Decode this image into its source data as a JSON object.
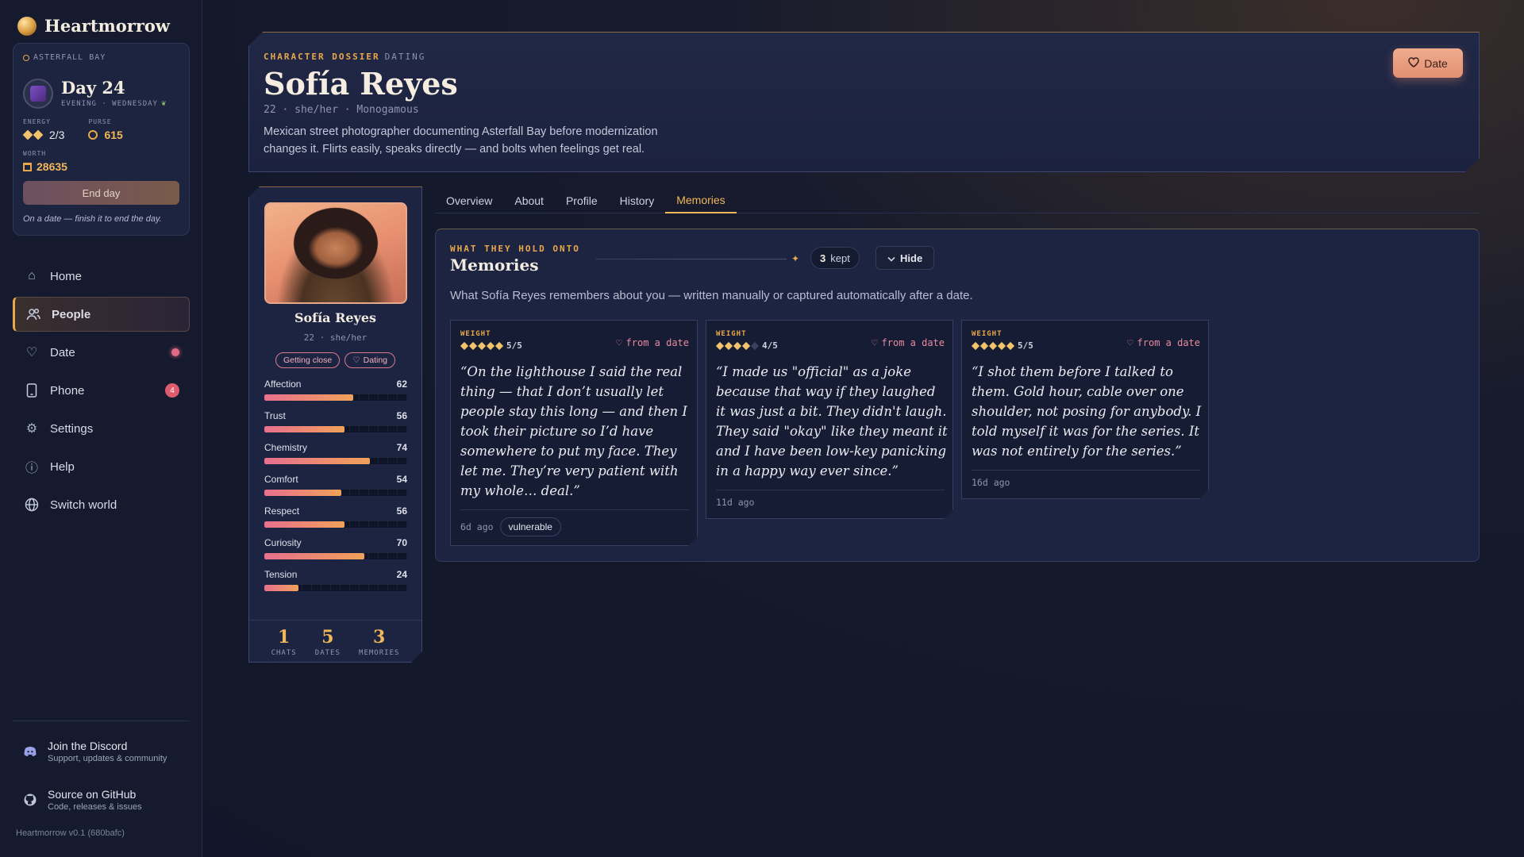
{
  "sidebar": {
    "brand": "Heartmorrow",
    "status": {
      "location": "ASTERFALL BAY",
      "day": "Day 24",
      "time": "EVENING · WEDNESDAY",
      "energy_label": "ENERGY",
      "energy_value": "2/3",
      "energy_current": 2,
      "energy_max": 3,
      "purse_label": "PURSE",
      "purse_value": "615",
      "worth_label": "WORTH",
      "worth_value": "28635",
      "end_day": "End day",
      "note": "On a date — finish it to end the day."
    },
    "nav": [
      {
        "label": "Home",
        "icon": "home-icon"
      },
      {
        "label": "People",
        "icon": "people-icon"
      },
      {
        "label": "Date",
        "icon": "heart-icon"
      },
      {
        "label": "Phone",
        "icon": "phone-icon",
        "badge": "4"
      },
      {
        "label": "Settings",
        "icon": "gear-icon"
      },
      {
        "label": "Help",
        "icon": "info-icon"
      },
      {
        "label": "Switch world",
        "icon": "globe-icon"
      }
    ],
    "discord": {
      "title": "Join the Discord",
      "sub": "Support, updates & community"
    },
    "github": {
      "title": "Source on GitHub",
      "sub": "Code, releases & issues"
    },
    "version": "Heartmorrow v0.1 (680bafc)"
  },
  "dossier": {
    "tag": "CHARACTER DOSSIER",
    "tag_status": "DATING",
    "name": "Sofía Reyes",
    "meta": "22 · she/her · Monogamous",
    "description": "Mexican street photographer documenting Asterfall Bay before modernization changes it. Flirts easily, speaks directly — and bolts when feelings get real.",
    "date_button": "Date"
  },
  "profile": {
    "name": "Sofía Reyes",
    "meta": "22 · she/her",
    "pills": [
      "Getting close",
      "Dating"
    ],
    "stats": [
      {
        "label": "Affection",
        "value": 62
      },
      {
        "label": "Trust",
        "value": 56
      },
      {
        "label": "Chemistry",
        "value": 74
      },
      {
        "label": "Comfort",
        "value": 54
      },
      {
        "label": "Respect",
        "value": 56
      },
      {
        "label": "Curiosity",
        "value": 70
      },
      {
        "label": "Tension",
        "value": 24
      }
    ],
    "totals": [
      {
        "num": "1",
        "label": "CHATS"
      },
      {
        "num": "5",
        "label": "DATES"
      },
      {
        "num": "3",
        "label": "MEMORIES"
      }
    ]
  },
  "tabs": [
    "Overview",
    "About",
    "Profile",
    "History",
    "Memories"
  ],
  "active_tab": "Memories",
  "memories": {
    "kicker": "WHAT THEY HOLD ONTO",
    "title": "Memories",
    "kept_count": "3",
    "kept_label": "kept",
    "hide": "Hide",
    "description": "What Sofía Reyes remembers about you — written manually or captured automatically after a date.",
    "items": [
      {
        "weight_label": "WEIGHT",
        "weight": 5,
        "score": "5/5",
        "source": "from a date",
        "quote": "“On the lighthouse I said the real thing — that I don’t usually let people stay this long — and then I took their picture so I’d have somewhere to put my face. They let me. They’re very patient with my whole… deal.”",
        "ago": "6d ago",
        "tag": "vulnerable"
      },
      {
        "weight_label": "WEIGHT",
        "weight": 4,
        "score": "4/5",
        "source": "from a date",
        "quote": "“I made us \"official\" as a joke because that way if they laughed it was just a bit. They didn't laugh. They said \"okay\" like they meant it and I have been low-key panicking in a happy way ever since.”",
        "ago": "11d ago",
        "tag": ""
      },
      {
        "weight_label": "WEIGHT",
        "weight": 5,
        "score": "5/5",
        "source": "from a date",
        "quote": "“I shot them before I talked to them. Gold hour, cable over one shoulder, not posing for anybody. I told myself it was for the series. It was not entirely for the series.”",
        "ago": "16d ago",
        "tag": ""
      }
    ]
  },
  "colors": {
    "accent": "#f1b75a",
    "pink": "#e86f8e",
    "bg": "#151a2e"
  }
}
